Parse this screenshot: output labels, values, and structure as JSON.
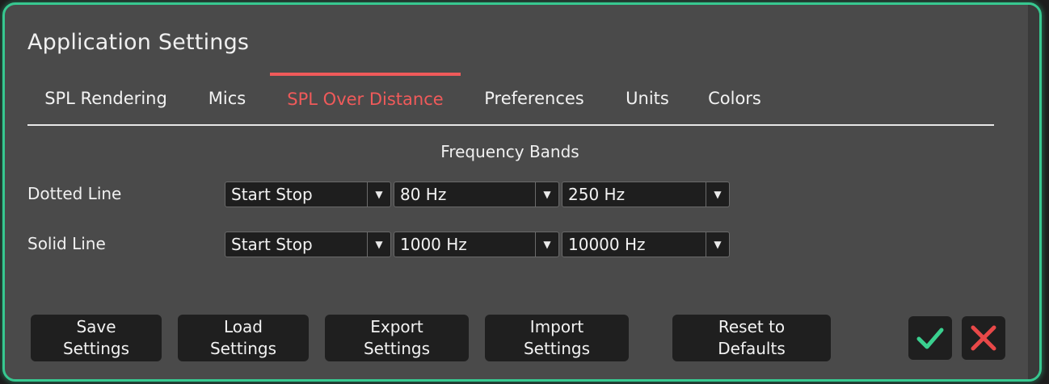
{
  "window": {
    "title": "Application Settings"
  },
  "tabs": [
    {
      "label": "SPL Rendering",
      "active": false
    },
    {
      "label": "Mics",
      "active": false
    },
    {
      "label": "SPL Over Distance",
      "active": true
    },
    {
      "label": "Preferences",
      "active": false
    },
    {
      "label": "Units",
      "active": false
    },
    {
      "label": "Colors",
      "active": false
    }
  ],
  "section": {
    "title": "Frequency Bands"
  },
  "rows": [
    {
      "label": "Dotted Line",
      "mode": "Start Stop",
      "start": "80 Hz",
      "stop": "250 Hz"
    },
    {
      "label": "Solid Line",
      "mode": "Start Stop",
      "start": "1000 Hz",
      "stop": "10000 Hz"
    }
  ],
  "buttons": {
    "save": "Save\nSettings",
    "load": "Load\nSettings",
    "export": "Export\nSettings",
    "import": "Import\nSettings",
    "reset": "Reset to\nDefaults"
  },
  "icons": {
    "confirm": "checkmark-icon",
    "cancel": "close-icon"
  },
  "colors": {
    "accent_active_tab": "#f05a5a",
    "frame_border": "#37c890",
    "confirm": "#3ad08f",
    "cancel": "#e84848"
  }
}
